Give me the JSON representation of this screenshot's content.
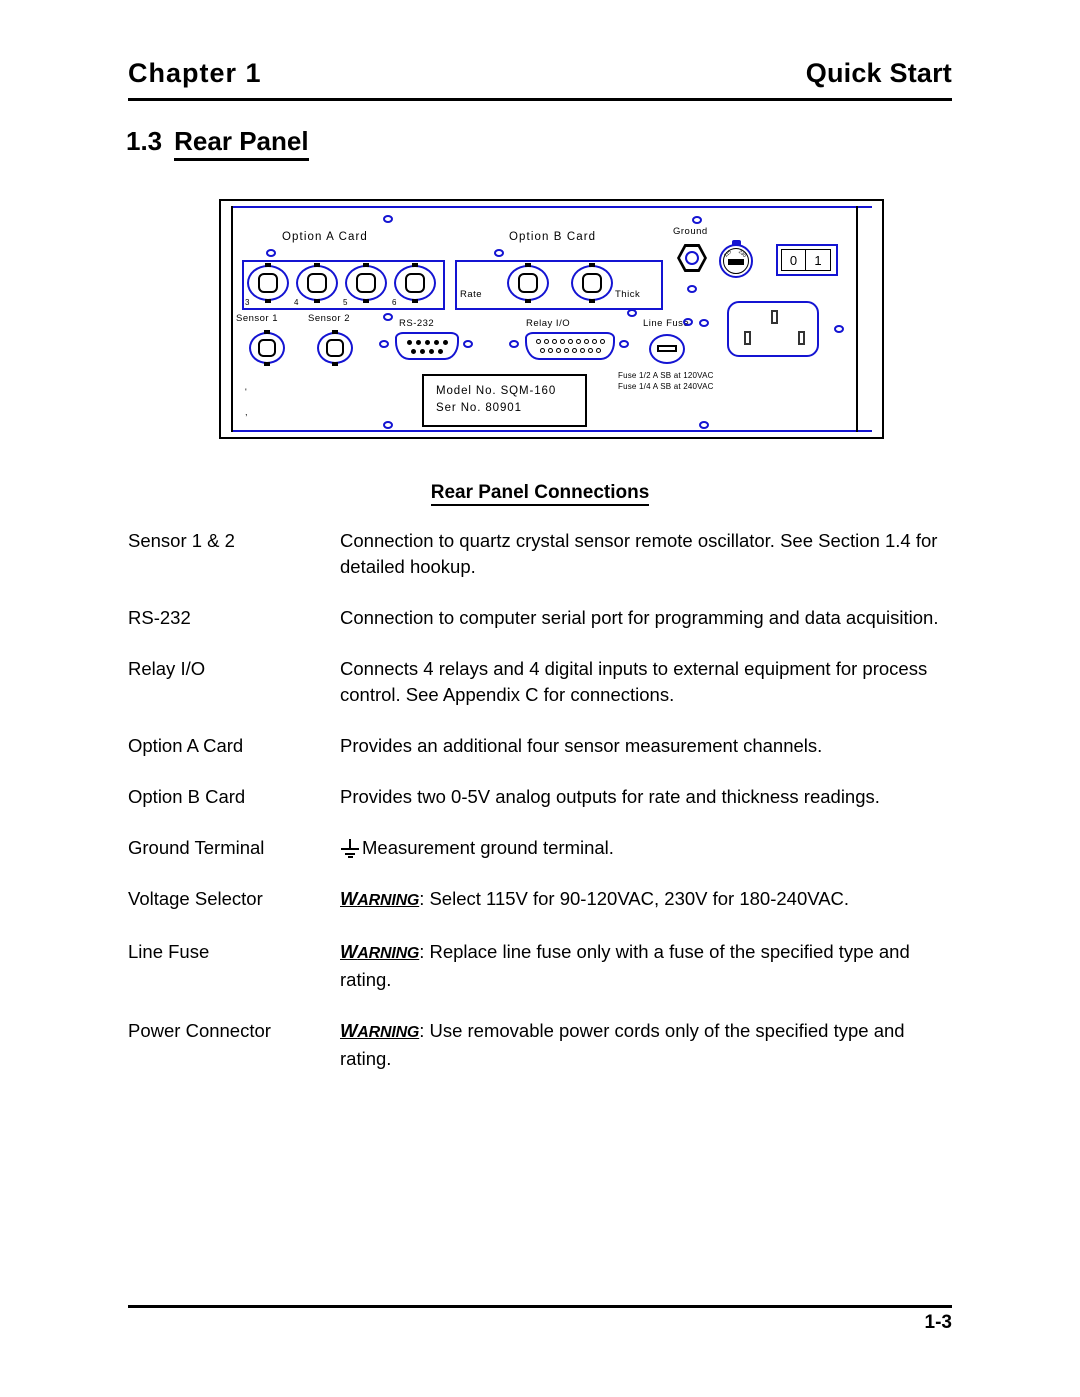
{
  "header": {
    "chapter": "Chapter  1",
    "section": "Quick Start"
  },
  "section_title": {
    "number": "1.3",
    "name": "Rear Panel"
  },
  "figure": {
    "labels": {
      "option_a_card": "Option A Card",
      "option_b_card": "Option B Card",
      "ground": "Ground",
      "rate": "Rate",
      "thick": "Thick",
      "sensor_1": "Sensor 1",
      "sensor_2": "Sensor 2",
      "rs232": "RS-232",
      "relay_io": "Relay I/O",
      "line_fuse": "Line Fuse"
    },
    "option_a_channels": [
      "3",
      "4",
      "5",
      "6"
    ],
    "power_switch": {
      "off": "0",
      "on": "1"
    },
    "voltage_dial": {
      "left_mark": "115",
      "right_mark": "230"
    },
    "nameplate": {
      "model": "Model No.  SQM-160",
      "serial": "Ser No.  80901"
    },
    "fuse_ratings": [
      "Fuse 1/2 A SB at 120VAC",
      "Fuse 1/4 A SB at 240VAC"
    ]
  },
  "table": {
    "heading": "Rear Panel Connections",
    "rows": [
      {
        "term": "Sensor 1 & 2",
        "desc": "Connection to quartz crystal sensor remote oscillator.  See Section 1.4 for detailed hookup."
      },
      {
        "term": "RS-232",
        "desc": "Connection to computer serial port for programming and data acquisition."
      },
      {
        "term": "Relay I/O",
        "desc": "Connects 4 relays and 4 digital inputs to external equipment for process control.  See Appendix C for connections."
      },
      {
        "term": "Option A Card",
        "desc": "Provides an additional four sensor measurement channels."
      },
      {
        "term": "Option B Card",
        "desc": "Provides two 0-5V analog outputs for rate and thickness readings."
      },
      {
        "term": "Ground Terminal",
        "icon": "ground-symbol",
        "desc": "Measurement ground terminal."
      },
      {
        "term": "Voltage Selector",
        "warning_prefix": "WARNING",
        "desc": ": Select 115V for 90-120VAC, 230V for 180-240VAC."
      },
      {
        "term": "Line Fuse",
        "warning_prefix": "WARNING",
        "desc": ": Replace line fuse only with a fuse of the specified type and rating."
      },
      {
        "term": "Power Connector",
        "warning_prefix": "WARNING",
        "desc": ": Use removable power cords only of the specified type and rating."
      }
    ]
  },
  "footer": {
    "page_number": "1-3"
  },
  "colors": {
    "line_blue": "#1414d2",
    "ink": "#000000",
    "paper": "#ffffff"
  }
}
